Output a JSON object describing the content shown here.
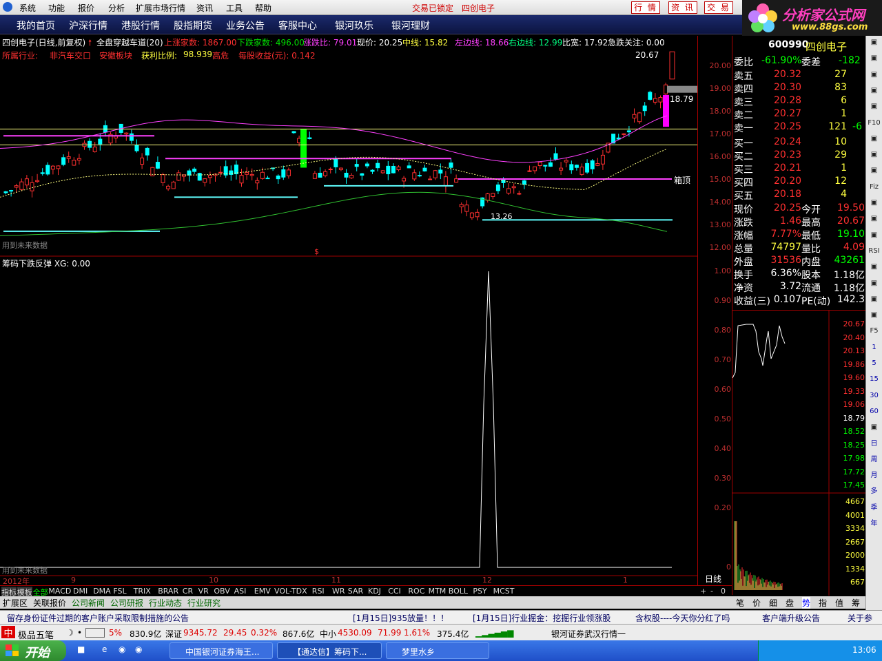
{
  "menu": {
    "items": [
      "系统",
      "功能",
      "报价",
      "分析",
      "扩展市场行情",
      "资讯",
      "工具",
      "帮助"
    ],
    "lock": "交易已锁定",
    "stock": "四创电子",
    "btn_quote": "行 情",
    "btn_info": "资 讯",
    "btn_trade": "交 易"
  },
  "logo": {
    "title": "分析家公式网",
    "url": "www.88gs.com"
  },
  "nav": [
    "我的首页",
    "沪深行情",
    "港股行情",
    "股指期货",
    "业务公告",
    "客服中心",
    "银河玖乐",
    "银河理财"
  ],
  "info": {
    "name": "四创电子(日线,前复权)",
    "indicator": "全盘穿越车道(20)",
    "up_label": "上涨家数: 1867.00",
    "down_label": "下跌家数: 496.00",
    "ratio": "涨跌比: 79.01",
    "price": "现价: 20.25",
    "mid": "中线: 15.82",
    "left": "左边线: 18.66",
    "right": "右边线: 12.99",
    "width": "比宽: 17.92",
    "watch": "急跌关注: 0.00",
    "industry": "所属行业:",
    "ind1": "非汽车交口",
    "ind2": "安徽板块",
    "profit": "获利比例:",
    "profit_val": "98.939",
    "risk": "高危",
    "eps": "每股收益(元): 0.142"
  },
  "chart_labels": {
    "high": "20.67",
    "mid_price": "18.79",
    "box_top": "箱顶",
    "low": "13.26",
    "nofuture1": "用到未来数据",
    "nofuture2": "用到未来数据",
    "lower_title": "筹码下跌反弹  XG: 0.00",
    "dollar": "$"
  },
  "price_axis": [
    "20.00",
    "19.00",
    "18.00",
    "17.00",
    "16.00",
    "15.00",
    "14.00",
    "13.00",
    "12.00"
  ],
  "lower_axis": [
    "1.00",
    "0.90",
    "0.80",
    "0.70",
    "0.60",
    "0.50",
    "0.40",
    "0.30",
    "0.20",
    "0"
  ],
  "date_axis": [
    "2012年",
    "9",
    "10",
    "11",
    "12",
    "1"
  ],
  "daily": "日线",
  "tabs": [
    "指标",
    "模板",
    "全部",
    "MACD",
    "DMI",
    "DMA",
    "FSL",
    "TRIX",
    "BRAR",
    "CR",
    "VR",
    "OBV",
    "ASI",
    "EMV",
    "VOL-TDX",
    "RSI",
    "WR",
    "SAR",
    "KDJ",
    "CCI",
    "ROC",
    "MTM",
    "BOLL",
    "PSY",
    "MCST"
  ],
  "tabs2": [
    "扩展区",
    "关联报价",
    "公司新闻",
    "公司研报",
    "行业动态",
    "行业研究"
  ],
  "quote": {
    "code": "600990",
    "name": "四创电子",
    "wb_label": "委比",
    "wb": "-61.90%",
    "wc_label": "委差",
    "wc": "-182",
    "asks": [
      [
        "卖五",
        "20.32",
        "27",
        ""
      ],
      [
        "卖四",
        "20.30",
        "83",
        ""
      ],
      [
        "卖三",
        "20.28",
        "6",
        ""
      ],
      [
        "卖二",
        "20.27",
        "1",
        ""
      ],
      [
        "卖一",
        "20.25",
        "121",
        "-6"
      ]
    ],
    "bids": [
      [
        "买一",
        "20.24",
        "10"
      ],
      [
        "买二",
        "20.23",
        "29"
      ],
      [
        "买三",
        "20.21",
        "1"
      ],
      [
        "买四",
        "20.20",
        "12"
      ],
      [
        "买五",
        "20.18",
        "4"
      ]
    ],
    "stats": [
      [
        "现价",
        "20.25",
        "今开",
        "19.50"
      ],
      [
        "涨跌",
        "1.46",
        "最高",
        "20.67"
      ],
      [
        "涨幅",
        "7.77%",
        "最低",
        "19.10"
      ],
      [
        "总量",
        "74797",
        "量比",
        "4.09"
      ],
      [
        "外盘",
        "31536",
        "内盘",
        "43261"
      ],
      [
        "换手",
        "6.36%",
        "股本",
        "1.18亿"
      ],
      [
        "净资",
        "3.72",
        "流通",
        "1.18亿"
      ],
      [
        "收益(三)",
        "0.107",
        "PE(动)",
        "142.3"
      ]
    ]
  },
  "mini_axis": [
    "20.67",
    "20.40",
    "20.13",
    "19.86",
    "19.60",
    "19.33",
    "19.06",
    "18.79",
    "18.52",
    "18.25",
    "17.98",
    "17.72",
    "17.45"
  ],
  "vol_axis": [
    "4667",
    "4001",
    "3334",
    "2667",
    "2000",
    "1334",
    "667"
  ],
  "bottabs": [
    "笔",
    "价",
    "细",
    "盘",
    "势",
    "指",
    "值",
    "筹"
  ],
  "sidebar": [
    "",
    "",
    "",
    "",
    "",
    "F10",
    "",
    "",
    "",
    "Fiz",
    "",
    "",
    "",
    "RSI",
    "",
    "",
    "",
    "",
    "F5",
    "1",
    "5",
    "15",
    "30",
    "60",
    "",
    "日",
    "周",
    "月",
    "多",
    "季",
    "年"
  ],
  "news": [
    "留存身份证件过期的客户账户采取限制措施的公告",
    "[1月15日]935放量！！！",
    "[1月15日]行业掘金：挖掘行业领涨股",
    "含权股----今天你分红了吗",
    "客户端升级公告",
    "关于参"
  ],
  "status": {
    "pct": "5%",
    "amt1": "830.9亿",
    "sz": "深证",
    "sz_val": "9345.72",
    "sz_chg": "29.45",
    "sz_pct": "0.32%",
    "amt2": "867.6亿",
    "zx": "中小",
    "zx_val": "4530.09",
    "zx_chg": "71.99",
    "zx_pct": "1.61%",
    "amt3": "375.4亿",
    "broker": "银河证券武汉行情一",
    "ime": "极品五笔"
  },
  "taskbar": {
    "start": "开始",
    "t1": "中国银河证券海王...",
    "t2": "【通达信】筹码下...",
    "t3": "梦里水乡",
    "clock": "13:06"
  },
  "colors": {
    "up": "#ff3030",
    "down": "#00ffff",
    "magenta": "#ff00ff",
    "yellow": "#ffff60",
    "green": "#30c030"
  }
}
